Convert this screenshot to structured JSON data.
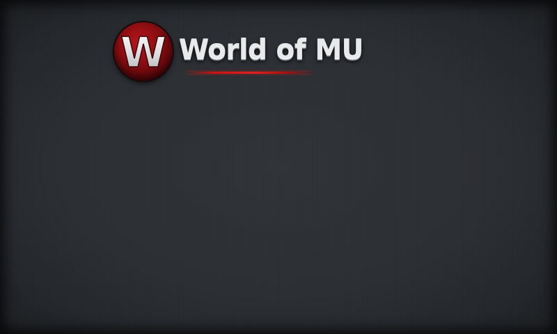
{
  "app": {
    "logo_letter": "W",
    "logo_name": "World of MU"
  },
  "colors": {
    "background": "#2b2e32",
    "badge": "#8e0e12",
    "logo_text": "#e8e9eb",
    "underline": "#d41a1a"
  },
  "icons": {
    "badge": "w-monogram-icon"
  }
}
